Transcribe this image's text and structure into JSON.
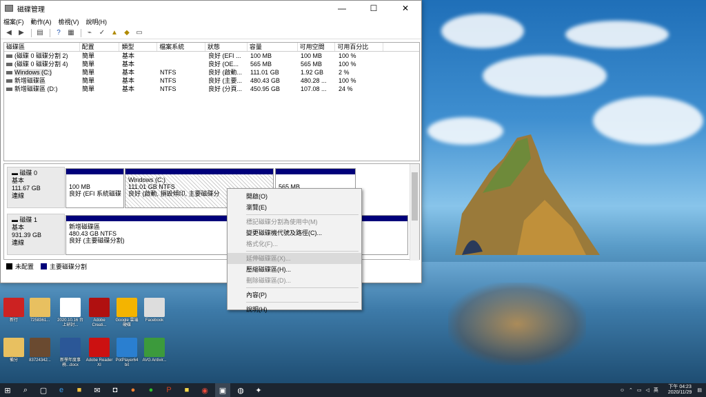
{
  "window": {
    "title": "磁碟管理",
    "controls": {
      "minimize": "—",
      "maximize": "☐",
      "close": "✕"
    }
  },
  "menu": [
    "檔案(F)",
    "動作(A)",
    "檢視(V)",
    "說明(H)"
  ],
  "columns": [
    "磁碟區",
    "配置",
    "類型",
    "檔案系統",
    "狀態",
    "容量",
    "可用空間",
    "可用百分比"
  ],
  "volumes": [
    {
      "name": "(磁碟 0 磁碟分割 2)",
      "layout": "簡單",
      "type": "基本",
      "fs": "",
      "status": "良好 (EFI ...",
      "capacity": "100 MB",
      "free": "100 MB",
      "pct": "100 %"
    },
    {
      "name": "(磁碟 0 磁碟分割 4)",
      "layout": "簡單",
      "type": "基本",
      "fs": "",
      "status": "良好 (OE...",
      "capacity": "565 MB",
      "free": "565 MB",
      "pct": "100 %"
    },
    {
      "name": "Windows (C:)",
      "layout": "簡單",
      "type": "基本",
      "fs": "NTFS",
      "status": "良好 (啟動...",
      "capacity": "111.01 GB",
      "free": "1.92 GB",
      "pct": "2 %"
    },
    {
      "name": "新增磁碟區",
      "layout": "簡單",
      "type": "基本",
      "fs": "NTFS",
      "status": "良好 (主要...",
      "capacity": "480.43 GB",
      "free": "480.28 ...",
      "pct": "100 %"
    },
    {
      "name": "新增磁碟區 (D:)",
      "layout": "簡單",
      "type": "基本",
      "fs": "NTFS",
      "status": "良好 (分頁...",
      "capacity": "450.95 GB",
      "free": "107.08 ...",
      "pct": "24 %"
    }
  ],
  "disks": [
    {
      "label": "磁碟 0",
      "type": "基本",
      "size": "111.67 GB",
      "state": "連線",
      "partitions": [
        {
          "line1": "",
          "line2": "100 MB",
          "line3": "良好 (EFI 系統磁碟"
        },
        {
          "line1": "Windows (C:)",
          "line2": "111.01 GB NTFS",
          "line3": "良好 (啟動, 損毀傾印, 主要磁碟分"
        },
        {
          "line1": "",
          "line2": "565 MB",
          "line3": ""
        }
      ]
    },
    {
      "label": "磁碟 1",
      "type": "基本",
      "size": "931.39 GB",
      "state": "連線",
      "partitions": [
        {
          "line1": "新增磁碟區",
          "line2": "480.43 GB NTFS",
          "line3": "良好 (主要磁碟分割)"
        }
      ]
    }
  ],
  "legend": {
    "unallocated": "未配置",
    "primary": "主要磁碟分割"
  },
  "context_menu": {
    "open": "開啟(O)",
    "explore": "瀏覽(E)",
    "mark_active": "標記磁碟分割為使用中(M)",
    "change_letter": "變更磁碟機代號及路徑(C)...",
    "format": "格式化(F)...",
    "extend": "延伸磁碟區(X)...",
    "shrink": "壓縮磁碟區(H)...",
    "delete": "刪除磁碟區(D)...",
    "properties": "內容(P)",
    "help": "說明(H)"
  },
  "desktop_icons": [
    {
      "label": "新行",
      "color": "#cc2222"
    },
    {
      "label": "7258361...",
      "color": "#e8c060"
    },
    {
      "label": "2020.10.16 台上研討...",
      "color": "#ffffff"
    },
    {
      "label": "Adobe Creati...",
      "color": "#b01010"
    },
    {
      "label": "Google 雲端 硬碟",
      "color": "#f4b400"
    },
    {
      "label": "Facebook",
      "color": "#dddddd"
    },
    {
      "label": "備分",
      "color": "#e8c060"
    },
    {
      "label": "83724342...",
      "color": "#6a4a30"
    },
    {
      "label": "新學年度事務...docx",
      "color": "#2b5797"
    },
    {
      "label": "Adobe Reader XI",
      "color": "#cc1111"
    },
    {
      "label": "PotPlayer64 bit",
      "color": "#2a7fd0"
    },
    {
      "label": "AVG Antivir...",
      "color": "#3c9a3c"
    }
  ],
  "taskbar": {
    "time": "下午 04:23",
    "date": "2020/11/29"
  },
  "colors": {
    "primary_partition": "#00007a",
    "unallocated": "#000000"
  }
}
